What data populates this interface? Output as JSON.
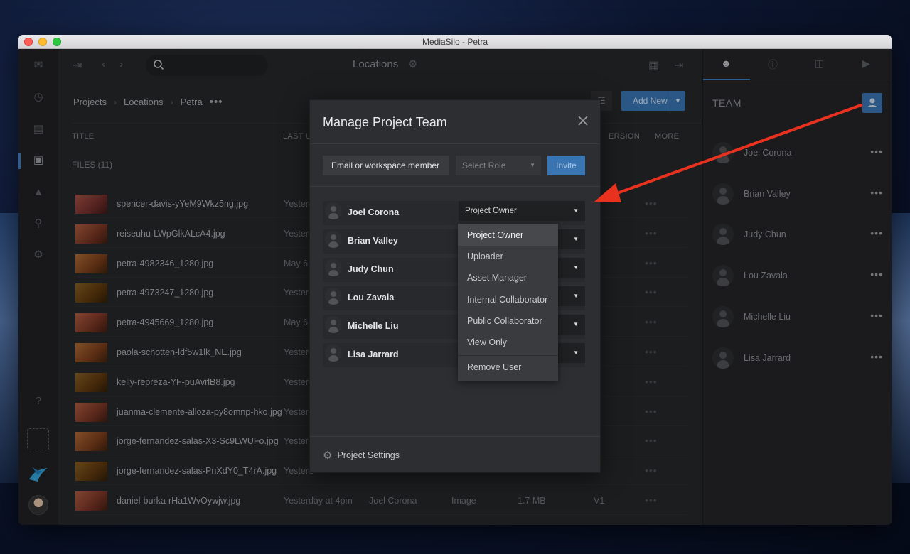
{
  "window": {
    "title": "MediaSilo - Petra"
  },
  "topbar": {
    "page_title": "Locations"
  },
  "breadcrumb": [
    "Projects",
    "Locations",
    "Petra"
  ],
  "toolbar": {
    "add_new_label": "Add New"
  },
  "table": {
    "headers": {
      "title": "TITLE",
      "last_updated": "LAST UP",
      "version": "ERSION",
      "more": "MORE"
    },
    "files_label": "FILES (11)",
    "rows": [
      {
        "name": "spencer-davis-yYeM9Wkz5ng.jpg",
        "date": "Yesterd"
      },
      {
        "name": "reiseuhu-LWpGlkALcA4.jpg",
        "date": "Yesterd"
      },
      {
        "name": "petra-4982346_1280.jpg",
        "date": "May 6"
      },
      {
        "name": "petra-4973247_1280.jpg",
        "date": "Yesterd"
      },
      {
        "name": "petra-4945669_1280.jpg",
        "date": "May 6"
      },
      {
        "name": "paola-schotten-ldf5w1lk_NE.jpg",
        "date": "Yesterd"
      },
      {
        "name": "kelly-repreza-YF-puAvrlB8.jpg",
        "date": "Yesterd"
      },
      {
        "name": "juanma-clemente-alloza-py8omnp-hko.jpg",
        "date": "Yesterd"
      },
      {
        "name": "jorge-fernandez-salas-X3-Sc9LWUFo.jpg",
        "date": "Yesterd"
      },
      {
        "name": "jorge-fernandez-salas-PnXdY0_T4rA.jpg",
        "date": "Yesterd"
      },
      {
        "name": "daniel-burka-rHa1WvOywjw.jpg",
        "date": "Yesterday at 4pm",
        "owner": "Joel Corona",
        "type": "Image",
        "size": "1.7 MB",
        "version": "V1"
      }
    ]
  },
  "team_panel": {
    "title": "TEAM",
    "members": [
      "Joel Corona",
      "Brian Valley",
      "Judy Chun",
      "Lou Zavala",
      "Michelle Liu",
      "Lisa Jarrard"
    ]
  },
  "modal": {
    "title": "Manage Project Team",
    "email_label": "Email or workspace member",
    "role_placeholder": "Select Role",
    "invite_label": "Invite",
    "members": [
      {
        "name": "Joel Corona",
        "role": "Project Owner"
      },
      {
        "name": "Brian Valley",
        "role": ""
      },
      {
        "name": "Judy Chun",
        "role": ""
      },
      {
        "name": "Lou Zavala",
        "role": ""
      },
      {
        "name": "Michelle Liu",
        "role": ""
      },
      {
        "name": "Lisa Jarrard",
        "role": ""
      }
    ],
    "settings_label": "Project Settings"
  },
  "role_dropdown": {
    "options": [
      "Project Owner",
      "Uploader",
      "Asset Manager",
      "Internal Collaborator",
      "Public Collaborator",
      "View Only"
    ],
    "remove_label": "Remove User",
    "selected": "Project Owner"
  },
  "colors": {
    "accent": "#3a75b3",
    "annotation_arrow": "#e8321f"
  }
}
